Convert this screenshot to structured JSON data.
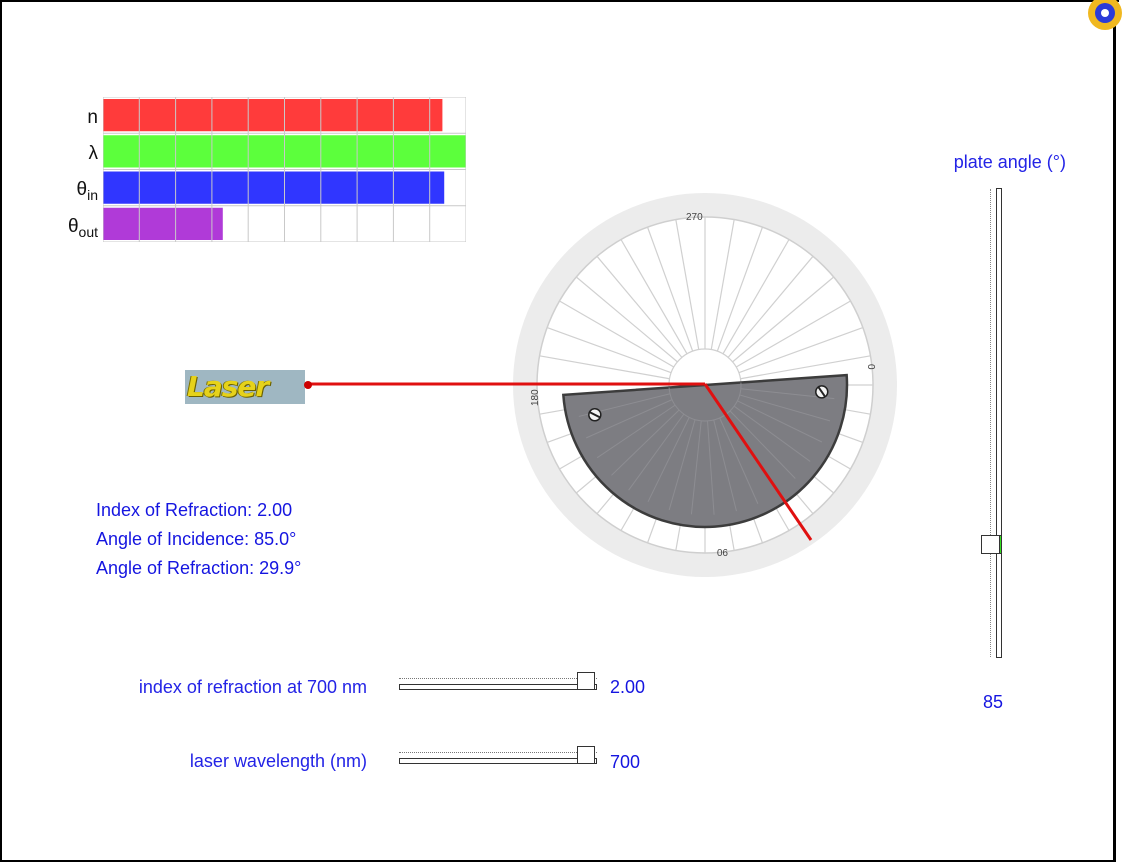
{
  "bar_graph": {
    "labels": [
      "n",
      "λ",
      "θ",
      "θ"
    ],
    "subscripts": [
      "",
      "",
      "in",
      "out"
    ],
    "bars": [
      {
        "name": "n",
        "fraction": 0.935,
        "color": "#ff3b3b"
      },
      {
        "name": "lambda",
        "fraction": 1.0,
        "color": "#5cff3c"
      },
      {
        "name": "theta_in",
        "fraction": 0.94,
        "color": "#3036ff"
      },
      {
        "name": "theta_out",
        "fraction": 0.33,
        "color": "#b03ad8"
      }
    ]
  },
  "readouts": {
    "index": "Index of Refraction: 2.00",
    "incidence": "Angle of Incidence: 85.0°",
    "refraction": "Angle of Refraction: 29.9°"
  },
  "protractor": {
    "labels": [
      "270",
      "0",
      "180",
      "90"
    ]
  },
  "laser": {
    "label": "Laser",
    "beam_color": "#e01010"
  },
  "controls": {
    "index_slider": {
      "label": "index of refraction at 700 nm",
      "value": "2.00"
    },
    "wavelength_slider": {
      "label": "laser wavelength (nm)",
      "value": "700"
    },
    "plate_angle": {
      "label": "plate angle (°)",
      "value": "85"
    }
  }
}
